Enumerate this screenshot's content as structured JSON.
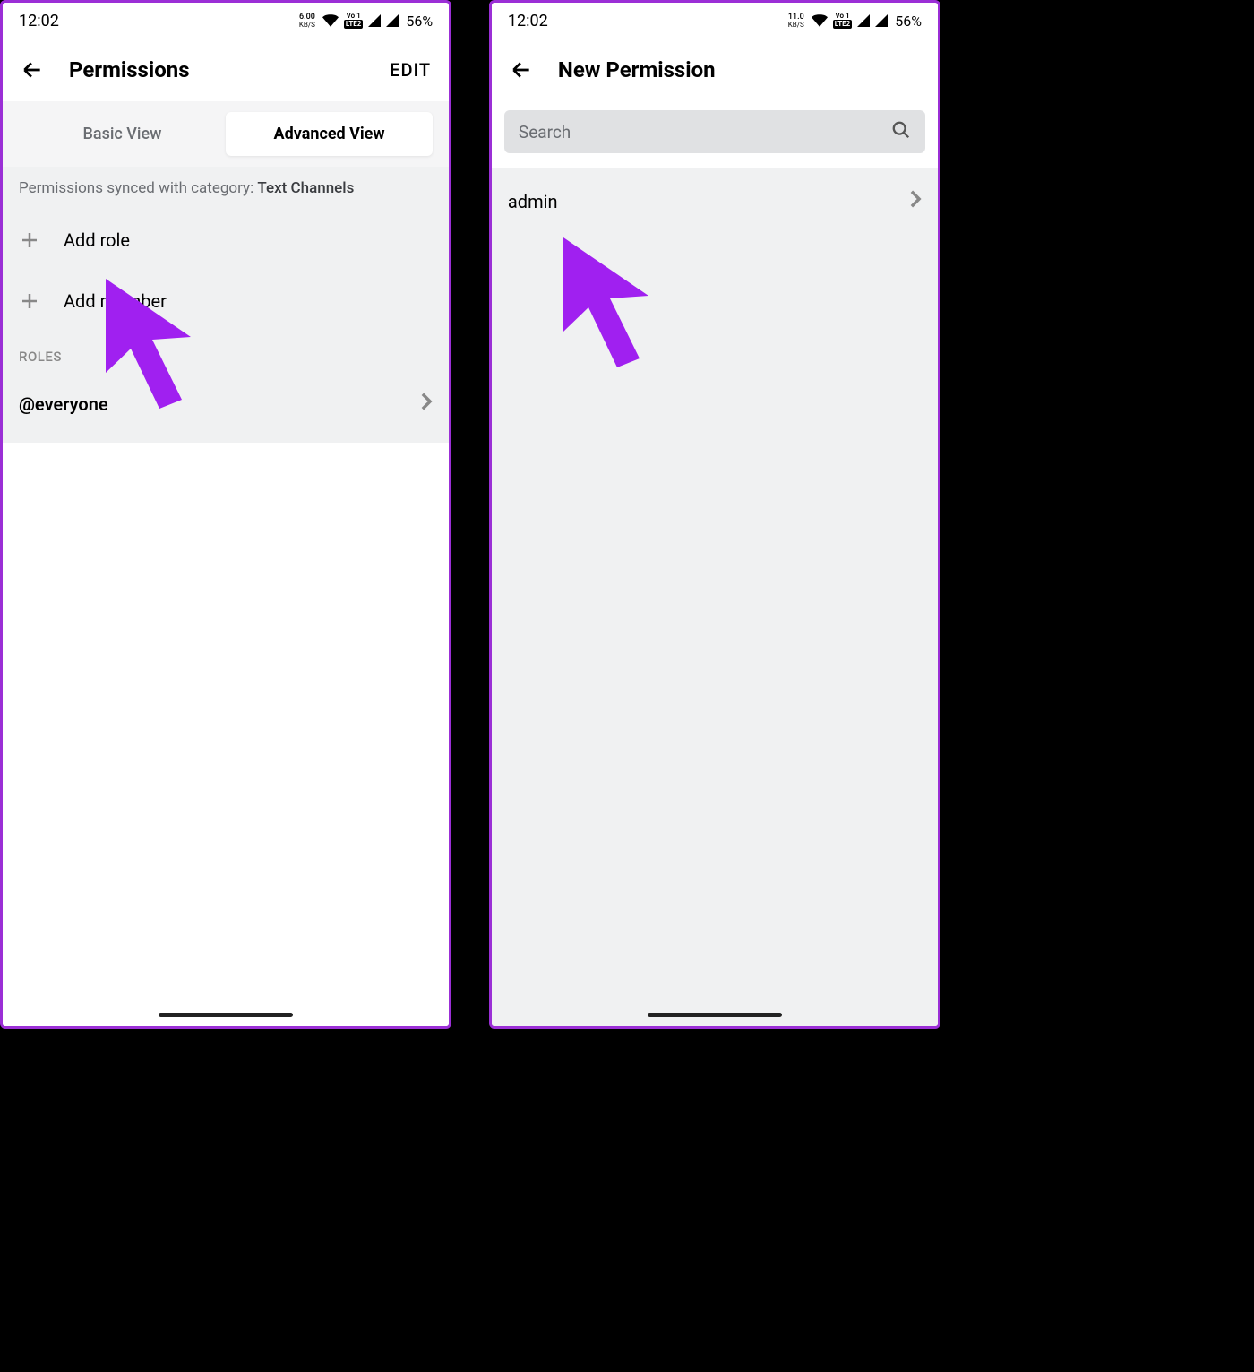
{
  "status": {
    "time": "12:02",
    "kbs1": "6.00",
    "kbs2": "11.0",
    "kbs_label": "KB/S",
    "vo": "Vo 1",
    "lte": "LTE2",
    "battery": "56%"
  },
  "screen1": {
    "header": {
      "title": "Permissions",
      "edit": "EDIT"
    },
    "tabs": {
      "basic": "Basic View",
      "advanced": "Advanced View"
    },
    "sync_text": "Permissions synced with category: ",
    "sync_category": "Text Channels",
    "add_role": "Add role",
    "add_member": "Add member",
    "roles_label": "ROLES",
    "role_everyone": "@everyone"
  },
  "screen2": {
    "header": {
      "title": "New Permission"
    },
    "search_placeholder": "Search",
    "result_admin": "admin"
  }
}
